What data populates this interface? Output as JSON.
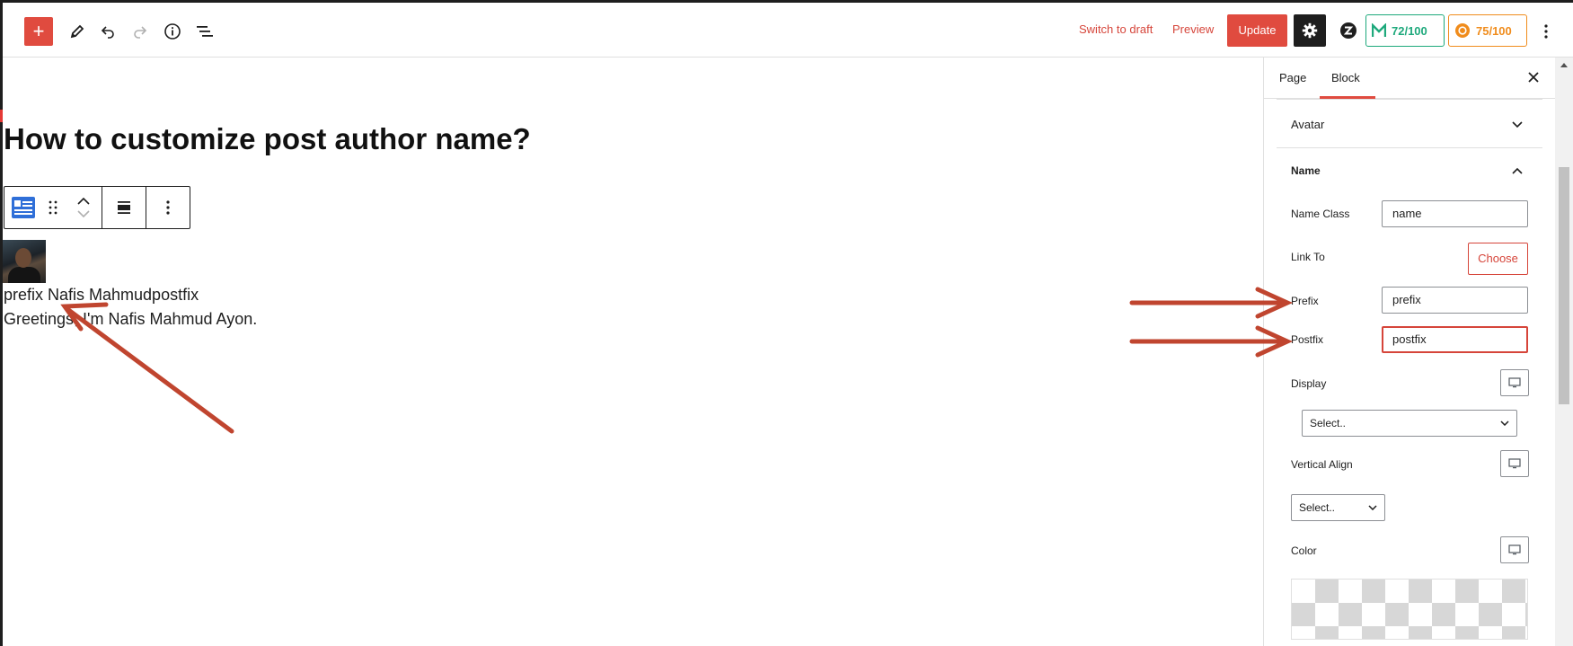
{
  "toolbar": {
    "switch_to_draft": "Switch to draft",
    "preview": "Preview",
    "update": "Update",
    "seo_score_1": "72/100",
    "seo_score_2": "75/100"
  },
  "editor": {
    "title": "How to customize post author name?",
    "author_line": "prefix Nafis Mahmudpostfix",
    "bio_line": "Greetings, I'm Nafis Mahmud Ayon."
  },
  "sidebar": {
    "tabs": [
      "Page",
      "Block"
    ],
    "active_tab": "Block",
    "panels": {
      "avatar": "Avatar",
      "name": "Name"
    },
    "fields": {
      "name_class_label": "Name Class",
      "name_class_value": "name",
      "link_to_label": "Link To",
      "choose_label": "Choose",
      "prefix_label": "Prefix",
      "prefix_value": "prefix",
      "postfix_label": "Postfix",
      "postfix_value": "postfix",
      "display_label": "Display",
      "display_select": "Select..",
      "vertical_align_label": "Vertical Align",
      "vertical_align_select": "Select..",
      "color_label": "Color"
    }
  },
  "colors": {
    "accent": "#e04b3f",
    "annotation_arrow": "#c0452f",
    "seo_green": "#1ea97c",
    "seo_orange": "#f08c1c"
  }
}
